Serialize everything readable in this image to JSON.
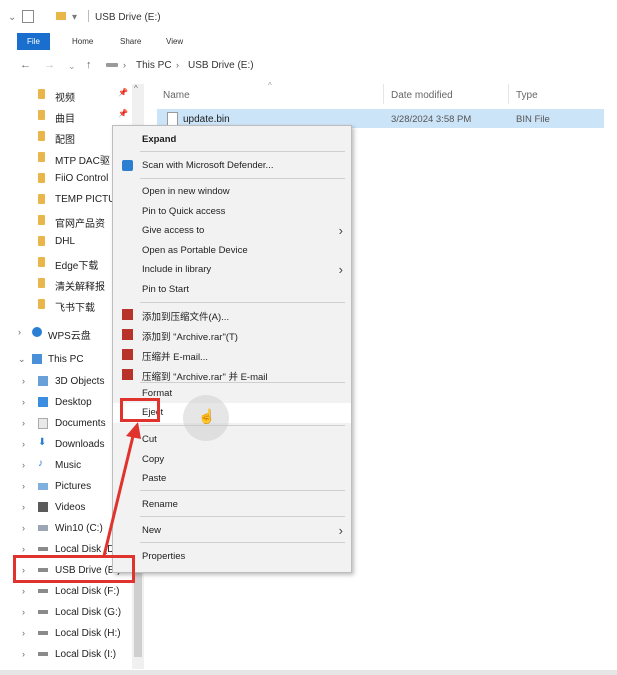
{
  "window": {
    "title": "USB Drive (E:)"
  },
  "ribbon": {
    "tabs": [
      "File",
      "Home",
      "Share",
      "View"
    ]
  },
  "address": {
    "crumbs": [
      "This PC",
      "USB Drive (E:)"
    ]
  },
  "nav_pane": {
    "quick_access": [
      "视频",
      "曲目",
      "配图",
      "MTP DAC驱",
      "FiiO Control",
      "TEMP PICTU",
      "官网产品资",
      "DHL",
      "Edge下载",
      "清关解释报",
      "飞书下载"
    ],
    "cloud": "WPS云盘",
    "this_pc": "This PC",
    "pc_items": [
      "3D Objects",
      "Desktop",
      "Documents",
      "Downloads",
      "Music",
      "Pictures",
      "Videos",
      "Win10 (C:)",
      "Local Disk (D",
      "USB Drive (E:)",
      "Local Disk (F:)",
      "Local Disk (G:)",
      "Local Disk (H:)",
      "Local Disk (I:)"
    ]
  },
  "file_list": {
    "columns": [
      "Name",
      "Date modified",
      "Type"
    ],
    "rows": [
      {
        "name": "update.bin",
        "date": "3/28/2024 3:58 PM",
        "type": "BIN File"
      }
    ]
  },
  "context_menu": {
    "items": [
      {
        "label": "Expand",
        "bold": true
      },
      {
        "label": "Scan with Microsoft Defender..."
      },
      {
        "label": "Open in new window"
      },
      {
        "label": "Pin to Quick access"
      },
      {
        "label": "Give access to",
        "submenu": true
      },
      {
        "label": "Open as Portable Device"
      },
      {
        "label": "Include in library",
        "submenu": true
      },
      {
        "label": "Pin to Start"
      },
      {
        "label": "添加到压缩文件(A)..."
      },
      {
        "label": "添加到 \"Archive.rar\"(T)"
      },
      {
        "label": "压缩并 E-mail..."
      },
      {
        "label": "压缩到 \"Archive.rar\" 并 E-mail"
      },
      {
        "label": "Format"
      },
      {
        "label": "Eject"
      },
      {
        "label": "Cut"
      },
      {
        "label": "Copy"
      },
      {
        "label": "Paste"
      },
      {
        "label": "Rename"
      },
      {
        "label": "New",
        "submenu": true
      },
      {
        "label": "Properties"
      }
    ]
  },
  "colors": {
    "accent": "#1a6fce",
    "highlight": "#e0332e",
    "selection": "#cce4f7"
  }
}
